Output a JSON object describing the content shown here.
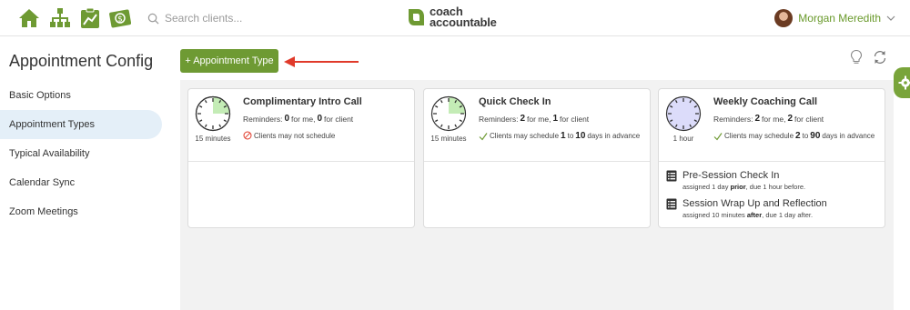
{
  "search": {
    "placeholder": "Search clients..."
  },
  "brand": {
    "line1": "coach",
    "line2": "accountable"
  },
  "user": {
    "name": "Morgan Meredith"
  },
  "sidebar": {
    "title": "Appointment Config",
    "items": [
      {
        "label": "Basic Options"
      },
      {
        "label": "Appointment Types",
        "active": true
      },
      {
        "label": "Typical Availability"
      },
      {
        "label": "Calendar Sync"
      },
      {
        "label": "Zoom Meetings"
      }
    ]
  },
  "toolbar": {
    "add_label": "+ Appointment Type"
  },
  "cards": [
    {
      "title": "Complimentary Intro Call",
      "duration": "15 minutes",
      "reminders": {
        "label": "Reminders:",
        "me": "0",
        "me_text": "for me,",
        "client": "0",
        "client_text": "for client"
      },
      "schedule": {
        "text": "Clients may not schedule"
      },
      "clock_icon": "clock-15-minutes-icon"
    },
    {
      "title": "Quick Check In",
      "duration": "15 minutes",
      "reminders": {
        "label": "Reminders:",
        "me": "2",
        "me_text": "for me,",
        "client": "1",
        "client_text": "for client"
      },
      "schedule": {
        "prefix": "Clients may schedule",
        "from": "1",
        "to_text": "to",
        "to": "10",
        "suffix": "days in advance"
      },
      "clock_icon": "clock-15-minutes-icon"
    },
    {
      "title": "Weekly Coaching Call",
      "duration": "1 hour",
      "reminders": {
        "label": "Reminders:",
        "me": "2",
        "me_text": "for me,",
        "client": "2",
        "client_text": "for client"
      },
      "schedule": {
        "prefix": "Clients may schedule",
        "from": "2",
        "to_text": "to",
        "to": "90",
        "suffix": "days in advance"
      },
      "clock_icon": "clock-1-hour-icon",
      "tasks": [
        {
          "title": "Pre-Session Check In",
          "sub_pre": "assigned 1 day",
          "sub_bold": "prior",
          "sub_post": ", due 1 hour before."
        },
        {
          "title": "Session Wrap Up and Reflection",
          "sub_pre": "assigned 10 minutes",
          "sub_bold": "after",
          "sub_post": ", due 1 day after."
        }
      ]
    }
  ],
  "colors": {
    "brand_green": "#6e9a33",
    "active_bg": "#e4eff8",
    "arrow_red": "#e03a2a",
    "main_bg": "#f2f2f2"
  }
}
